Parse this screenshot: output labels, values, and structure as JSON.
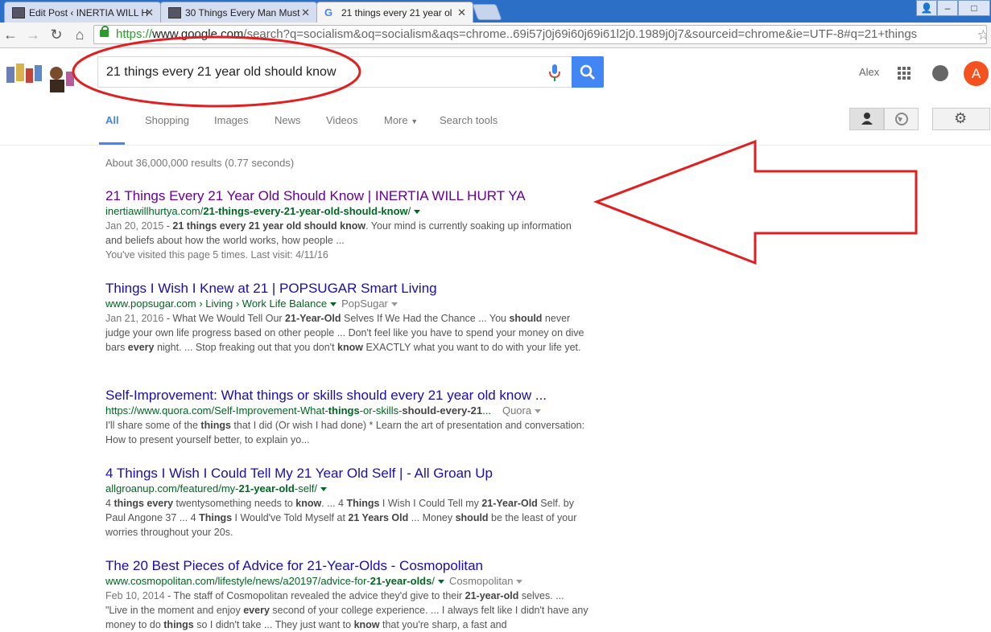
{
  "browser": {
    "tabs": [
      {
        "label": "Edit Post ‹ INERTIA WILL H"
      },
      {
        "label": "30 Things Every Man Must"
      },
      {
        "label": "21 things every 21 year ol"
      }
    ],
    "url": {
      "scheme": "https://",
      "host": "www.google.com",
      "rest": "/search?q=socialism&oq=socialism&aqs=chrome..69i57j0j69i60j69i61l2j0.1989j0j7&sourceid=chrome&ie=UTF-8#q=21+things"
    }
  },
  "google": {
    "query": "21 things every 21 year old should know",
    "user_name": "Alex",
    "avatar_letter": "A",
    "tabs": [
      "All",
      "Shopping",
      "Images",
      "News",
      "Videos",
      "More",
      "Search tools"
    ],
    "stats": "About 36,000,000 results (0.77 seconds)"
  },
  "results": [
    {
      "title": "21 Things Every 21 Year Old Should Know | INERTIA WILL HURT YA",
      "url_pre": "inertiawillhurtya.com/",
      "url_bold": "21-things-every-21-year-old-should-know",
      "url_post": "/",
      "source": "",
      "date": "Jan 20, 2015",
      "snippet": " - <b>21 things every 21 year old should know</b>. Your mind is currently soaking up information and beliefs about how the world works, how people ...",
      "visited": "You've visited this page 5 times. Last visit: 4/11/16"
    },
    {
      "title": "Things I Wish I Knew at 21 | POPSUGAR Smart Living",
      "url_pre": "www.popsugar.com › Living › Work Life Balance",
      "url_bold": "",
      "url_post": "",
      "source": "PopSugar",
      "date": "Jan 21, 2016",
      "snippet": " - What We Would Tell Our <b>21-Year-Old</b> Selves If We Had the Chance ... You <b>should</b> never judge your own life progress based on other people ... Don't feel like you have to spend your money on dive bars <b>every</b> night. ... Stop freaking out that you don't <b>know</b> EXACTLY what you want to do with your life yet.",
      "visited": ""
    },
    {
      "title": "Self-Improvement: What things or skills should every 21 year old know ...",
      "url_pre": "https://www.quora.com/Self-Improvement-What-",
      "url_bold": "things",
      "url_post": "-or-skills-<b>should-every-21</b>...",
      "source": "Quora",
      "date": "",
      "snippet": "I'll share some of the <b>things</b> that I did (Or wish I had done) * Learn the art of presentation and conversation: How to present yourself better, to explain yo...",
      "visited": ""
    },
    {
      "title": "4 Things I Wish I Could Tell My 21 Year Old Self | - All Groan Up",
      "url_pre": "allgroanup.com/featured/my-",
      "url_bold": "21-year-old",
      "url_post": "-self/",
      "source": "",
      "date": "",
      "snippet": "4 <b>things every</b> twentysomething needs to <b>know</b>. ... 4 <b>Things</b> I Wish I Could Tell my <b>21-Year-Old</b> Self. by Paul Angone 37 ... 4 <b>Things</b> I Would've Told Myself at <b>21 Years Old</b> ... Money <b>should</b> be the least of your worries throughout your 20s.",
      "visited": ""
    },
    {
      "title": "The 20 Best Pieces of Advice for 21-Year-Olds - Cosmopolitan",
      "url_pre": "www.cosmopolitan.com/lifestyle/news/a20197/advice-for-",
      "url_bold": "21-year-olds",
      "url_post": "/",
      "source": "Cosmopolitan",
      "date": "Feb 10, 2014",
      "snippet": " - The staff of Cosmopolitan revealed the advice they'd give to their <b>21-year-old</b> selves. ... \"Live in the moment and enjoy <b>every</b> second of your college experience. ... I always felt like I didn't have any money to do <b>things</b> so I didn't take ... They just want to <b>know</b> that you're sharp, a fast and",
      "visited": ""
    }
  ],
  "colors": {
    "link": "#1a0dab",
    "visited": "#660099",
    "url_green": "#006621",
    "annotation_red": "#e02020",
    "google_blue": "#4285f4"
  }
}
